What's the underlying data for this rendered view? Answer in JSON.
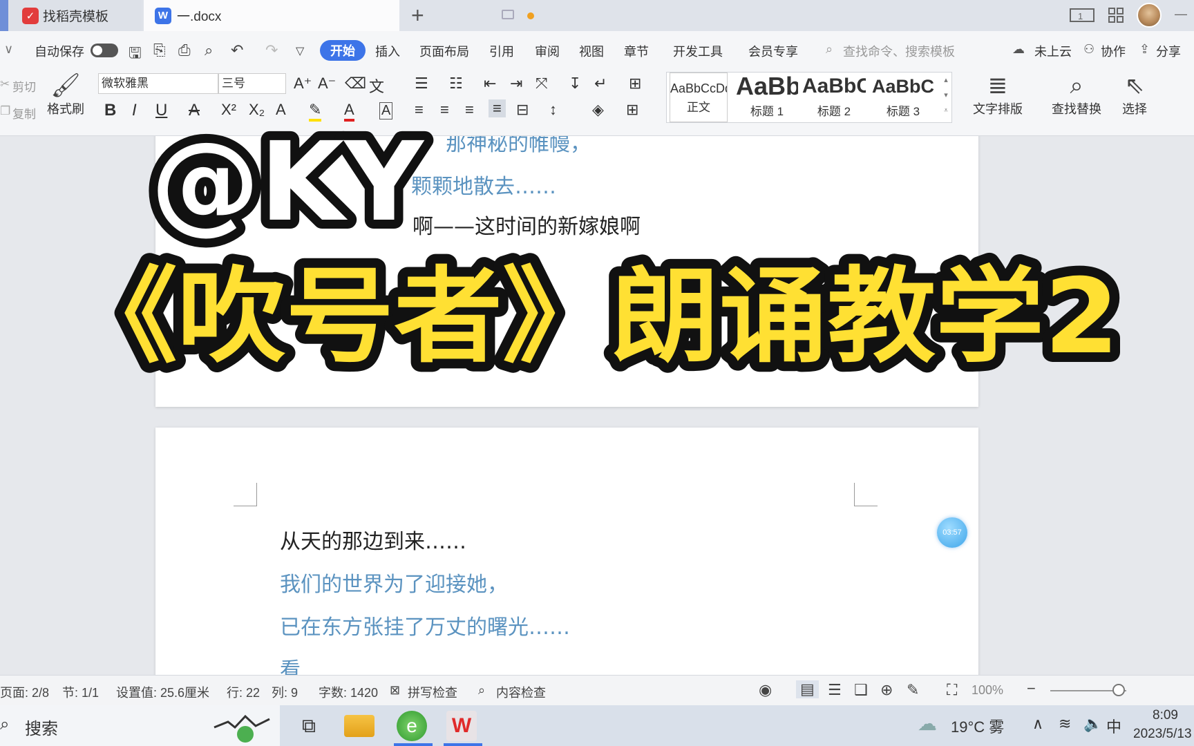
{
  "tabs": [
    {
      "label": "找稻壳模板"
    },
    {
      "label": "一.docx"
    }
  ],
  "menu": {
    "autosave": "自动保存",
    "items": [
      "开始",
      "插入",
      "页面布局",
      "引用",
      "审阅",
      "视图",
      "章节",
      "开发工具",
      "会员专享"
    ],
    "search_placeholder": "查找命令、搜索模板",
    "cloud": "未上云",
    "collab": "协作",
    "share": "分享"
  },
  "ribbon": {
    "cut": "剪切",
    "copy": "复制",
    "format_painter": "格式刷",
    "font": "微软雅黑",
    "size": "三号",
    "styles": [
      {
        "sample": "AaBbCcDd",
        "name": "正文"
      },
      {
        "sample": "AaBb",
        "name": "标题 1"
      },
      {
        "sample": "AaBbC",
        "name": "标题 2"
      },
      {
        "sample": "AaBbC",
        "name": "标题 3"
      }
    ],
    "text_layout": "文字排版",
    "find_replace": "查找替换",
    "select": "选择"
  },
  "document": {
    "page1_lines": [
      {
        "text": "那神秘的帷幔，",
        "color": "blue"
      },
      {
        "text": "颗颗地散去……",
        "color": "blue"
      },
      {
        "text": "啊——这时间的新嫁娘啊",
        "color": "black"
      }
    ],
    "page2_lines": [
      {
        "text": "从天的那边到来……",
        "color": "black"
      },
      {
        "text": "我们的世界为了迎接她，",
        "color": "blue"
      },
      {
        "text": "已在东方张挂了万丈的曙光……",
        "color": "blue"
      },
      {
        "text": "看",
        "color": "blue"
      }
    ],
    "timer": "03:57"
  },
  "overlay": {
    "handle": "@KY",
    "title": "《吹号者》朗诵教学2"
  },
  "status": {
    "page": "页面: 2/8",
    "section": "节: 1/1",
    "setting": "设置值: 25.6厘米",
    "row": "行: 22",
    "col": "列: 9",
    "words": "字数: 1420",
    "spell": "拼写检查",
    "content": "内容检查",
    "zoom": "100%"
  },
  "taskbar": {
    "search": "搜索",
    "weather": "19°C 雾",
    "ime": "中",
    "time": "8:09",
    "date": "2023/5/13"
  },
  "colors": {
    "accent": "#3d74e8",
    "blue_text": "#5b93c0",
    "overlay_yellow": "#ffe033",
    "overlay_outline": "#111111"
  }
}
